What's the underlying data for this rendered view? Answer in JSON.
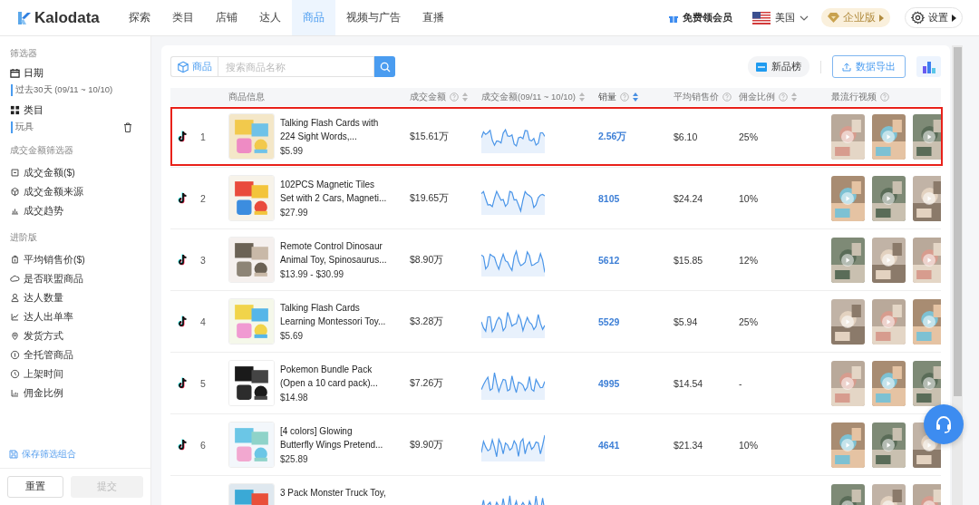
{
  "header": {
    "logo": "Kalodata",
    "nav": [
      {
        "label": "探索",
        "selected": false
      },
      {
        "label": "类目",
        "selected": false
      },
      {
        "label": "店铺",
        "selected": false
      },
      {
        "label": "达人",
        "selected": false
      },
      {
        "label": "商品",
        "selected": true
      },
      {
        "label": "视频与广告",
        "selected": false
      },
      {
        "label": "直播",
        "selected": false
      }
    ],
    "membership": "免费领会员",
    "region": "美国",
    "plan": "企业版",
    "settings": "设置"
  },
  "sidebar": {
    "title": "筛选器",
    "filters": [
      {
        "label": "日期",
        "value": "过去30天 (09/11 ~ 10/10)",
        "removable": false
      },
      {
        "label": "类目",
        "value": "玩具",
        "removable": true
      }
    ],
    "sections": [
      {
        "title": "成交金额筛选器",
        "items": [
          "成交金额($)",
          "成交金额来源",
          "成交趋势"
        ]
      },
      {
        "title": "进阶版",
        "items": [
          "平均销售价($)",
          "是否联盟商品",
          "达人数量",
          "达人出单率",
          "发货方式",
          "全托管商品",
          "上架时间",
          "佣金比例"
        ]
      }
    ],
    "save_link": "保存筛选组合",
    "buttons": [
      {
        "label": "重置",
        "disabled": false
      },
      {
        "label": "提交",
        "disabled": true
      }
    ]
  },
  "toolbar": {
    "search_scope": "商品",
    "search": {
      "placeholder": "搜索商品名称"
    },
    "new_list": "新品榜",
    "export": "数据导出"
  },
  "table": {
    "columns": [
      {
        "label": "商品信息",
        "help": false,
        "sortable": false,
        "sort_active": false
      },
      {
        "label": "成交金额",
        "help": true,
        "sortable": true,
        "sort_active": false
      },
      {
        "label": "成交金额(09/11 ~ 10/10)",
        "help": false,
        "sortable": true,
        "sort_active": false
      },
      {
        "label": "销量",
        "help": true,
        "sortable": true,
        "sort_active": true
      },
      {
        "label": "平均销售价",
        "help": true,
        "sortable": false,
        "sort_active": false
      },
      {
        "label": "佣金比例",
        "help": true,
        "sortable": true,
        "sort_active": false
      },
      {
        "label": "最流行视频",
        "help": true,
        "sortable": false,
        "sort_active": false
      }
    ],
    "rows": [
      {
        "rank": "1",
        "title_lines": [
          "Talking Flash Cards with",
          "224 Sight Words,..."
        ],
        "price": "$5.99",
        "gmv": "$15.61万",
        "sales": "2.56万",
        "avg_price": "$6.10",
        "commission": "25%",
        "highlighted": true
      },
      {
        "rank": "2",
        "title_lines": [
          "102PCS Magnetic Tiles",
          "Set with 2 Cars, Magneti..."
        ],
        "price": "$27.99",
        "gmv": "$19.65万",
        "sales": "8105",
        "avg_price": "$24.24",
        "commission": "10%",
        "highlighted": false
      },
      {
        "rank": "3",
        "title_lines": [
          "Remote Control Dinosaur",
          "Animal Toy, Spinosaurus..."
        ],
        "price": "$13.99 - $30.99",
        "gmv": "$8.90万",
        "sales": "5612",
        "avg_price": "$15.85",
        "commission": "12%",
        "highlighted": false
      },
      {
        "rank": "4",
        "title_lines": [
          "Talking Flash Cards",
          "Learning Montessori Toy..."
        ],
        "price": "$5.69",
        "gmv": "$3.28万",
        "sales": "5529",
        "avg_price": "$5.94",
        "commission": "25%",
        "highlighted": false
      },
      {
        "rank": "5",
        "title_lines": [
          "Pokemon Bundle Pack",
          "(Open a 10 card pack)..."
        ],
        "price": "$14.98",
        "gmv": "$7.26万",
        "sales": "4995",
        "avg_price": "$14.54",
        "commission": "-",
        "highlighted": false
      },
      {
        "rank": "6",
        "title_lines": [
          "[4 colors] Glowing",
          "Butterfly Wings Pretend..."
        ],
        "price": "$25.89",
        "gmv": "$9.90万",
        "sales": "4641",
        "avg_price": "$21.34",
        "commission": "10%",
        "highlighted": false
      },
      {
        "title_lines": [
          "3 Pack Monster Truck Toy,"
        ],
        "highlighted": false
      }
    ]
  }
}
